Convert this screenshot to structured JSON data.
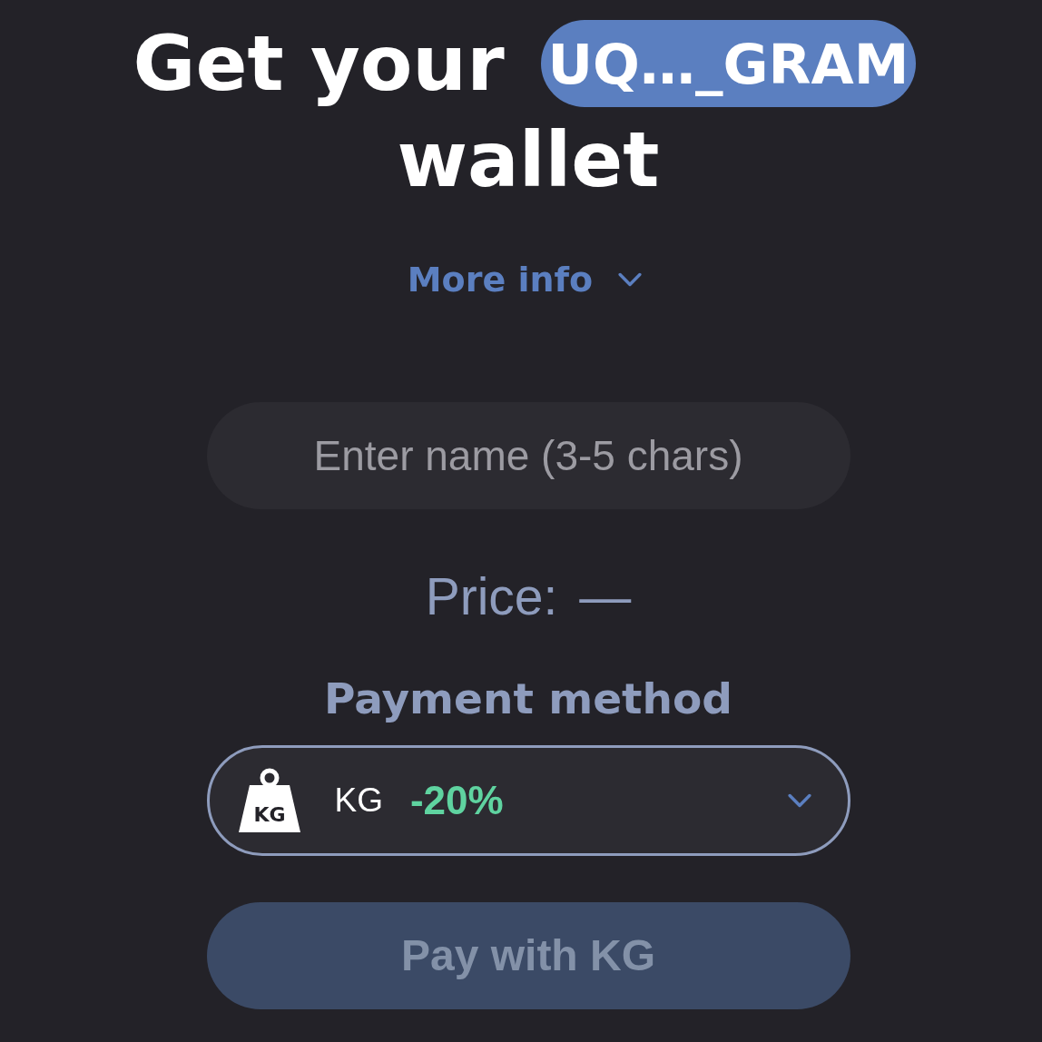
{
  "title": {
    "prefix": "Get your",
    "address": "UQ…_GRAM",
    "suffix": "wallet"
  },
  "more_info": {
    "label": "More info",
    "expanded": false
  },
  "name_field": {
    "placeholder": "Enter name (3-5 chars)"
  },
  "price": {
    "label": "Price:",
    "value": "—"
  },
  "payment": {
    "heading": "Payment method",
    "selected": {
      "icon_text": "KG",
      "currency": "KG",
      "discount": "-20%"
    }
  },
  "pay_button": {
    "label": "Pay with KG",
    "disabled": true
  }
}
